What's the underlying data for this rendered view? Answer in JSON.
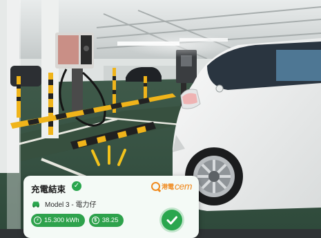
{
  "scene": {
    "description_icons": [
      "ev-charging-station-icon",
      "parking-stopper-icon",
      "white-car-icon"
    ]
  },
  "card": {
    "title": "充電結束",
    "vehicle": "Model 3 - 電力仔",
    "energy": "15.300 kWh",
    "cost": "38.25",
    "brand_cn": "港電",
    "brand_en": "cem",
    "accent_color": "#2aa64e",
    "brand_color": "#f08a1e"
  }
}
